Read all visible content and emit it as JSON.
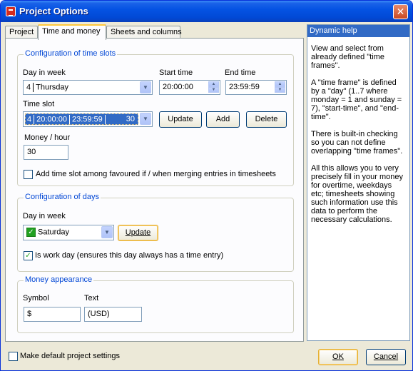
{
  "window": {
    "title": "Project Options",
    "close_label": "✕"
  },
  "tabs": [
    {
      "label": "Project"
    },
    {
      "label": "Time and money"
    },
    {
      "label": "Sheets and columns"
    }
  ],
  "time_slots": {
    "group_title": "Configuration of time slots",
    "day_label": "Day in week",
    "day_number": "4",
    "day_value": "Thursday",
    "start_label": "Start time",
    "start_value": "20:00:00",
    "end_label": "End time",
    "end_value": "23:59:59",
    "slot_label": "Time slot",
    "slot_day": "4",
    "slot_start": "20:00:00",
    "slot_end": "23:59:59",
    "slot_amount": "30",
    "update_button": "Update",
    "add_button": "Add",
    "delete_button": "Delete",
    "money_label": "Money / hour",
    "money_value": "30",
    "favoured_checkbox": "Add time slot among favoured if / when merging entries in timesheets"
  },
  "days": {
    "group_title": "Configuration of days",
    "day_label": "Day in week",
    "day_value": "Saturday",
    "update_button": "Update",
    "workday_checkbox": "Is work day (ensures this day always has a time entry)"
  },
  "money": {
    "group_title": "Money appearance",
    "symbol_label": "Symbol",
    "symbol_value": "$",
    "text_label": "Text",
    "text_value": "(USD)"
  },
  "help": {
    "title": "Dynamic help",
    "paragraphs": [
      "View and select from already defined \"time frames\".",
      "A \"time frame\" is defined by a \"day\" (1..7 where monday = 1 and sunday = 7), \"start-time\", and \"end-time\".",
      "There is built-in checking so you can not define overlapping \"time frames\".",
      "All this allows you to very precisely fill in your money for overtime, weekdays etc; timesheets showing such information use this data to perform the necessary calculations."
    ]
  },
  "footer": {
    "default_checkbox": "Make default project settings",
    "ok_button": "OK",
    "cancel_button": "Cancel"
  },
  "icons": {
    "dropdown": "chevron-down-icon",
    "spin": "spin-updown-icon",
    "check": "checkmark-icon",
    "app": "app-icon",
    "close": "close-icon"
  },
  "colors": {
    "titlebar": "#0553e3",
    "group_title": "#0046d5",
    "selection": "#316ac5",
    "window_bg": "#ece9d8"
  }
}
